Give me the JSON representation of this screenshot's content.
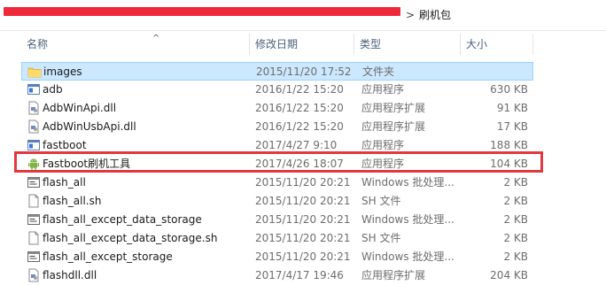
{
  "address": {
    "redacted_text": "_ _ _ _ _ _ _ _ _ _ _ _ _ _ _",
    "separator": ">",
    "folder": "刷机包"
  },
  "header": {
    "name": "名称",
    "date": "修改日期",
    "type": "类型",
    "size": "大小",
    "sort_arrow": "^"
  },
  "rows": [
    {
      "name": "images",
      "date": "2015/11/20 17:52",
      "type": "文件夹",
      "size": "",
      "icon": "folder-icon",
      "selected": true
    },
    {
      "name": "adb",
      "date": "2016/1/22 15:20",
      "type": "应用程序",
      "size": "630 KB",
      "icon": "exe-icon"
    },
    {
      "name": "AdbWinApi.dll",
      "date": "2016/1/22 15:20",
      "type": "应用程序扩展",
      "size": "91 KB",
      "icon": "dll-icon"
    },
    {
      "name": "AdbWinUsbApi.dll",
      "date": "2016/1/22 15:20",
      "type": "应用程序扩展",
      "size": "17 KB",
      "icon": "dll-icon"
    },
    {
      "name": "fastboot",
      "date": "2017/4/27 9:10",
      "type": "应用程序",
      "size": "188 KB",
      "icon": "exe-icon"
    },
    {
      "name": "Fastboot刷机工具",
      "date": "2017/4/26 18:07",
      "type": "应用程序",
      "size": "104 KB",
      "icon": "android-icon"
    },
    {
      "name": "flash_all",
      "date": "2015/11/20 20:21",
      "type": "Windows 批处理...",
      "size": "2 KB",
      "icon": "bat-icon"
    },
    {
      "name": "flash_all.sh",
      "date": "2015/11/20 20:21",
      "type": "SH 文件",
      "size": "2 KB",
      "icon": "file-icon"
    },
    {
      "name": "flash_all_except_data_storage",
      "date": "2015/11/20 20:21",
      "type": "Windows 批处理...",
      "size": "2 KB",
      "icon": "bat-icon"
    },
    {
      "name": "flash_all_except_data_storage.sh",
      "date": "2015/11/20 20:21",
      "type": "SH 文件",
      "size": "2 KB",
      "icon": "file-icon"
    },
    {
      "name": "flash_all_except_storage",
      "date": "2015/11/20 20:21",
      "type": "Windows 批处理...",
      "size": "2 KB",
      "icon": "bat-icon"
    },
    {
      "name": "flashdll.dll",
      "date": "2017/4/17 19:46",
      "type": "应用程序扩展",
      "size": "204 KB",
      "icon": "dll-icon"
    }
  ],
  "colors": {
    "highlight": "#e0393e",
    "selection": "#cce8ff",
    "header_text": "#4c607a"
  }
}
